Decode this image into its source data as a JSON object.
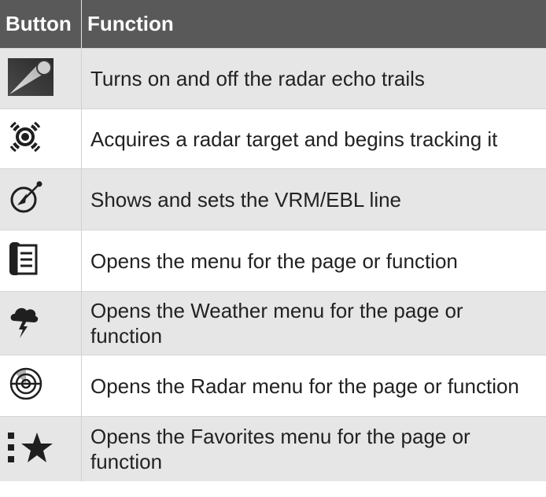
{
  "table": {
    "headers": {
      "button": "Button",
      "function": "Function"
    },
    "rows": [
      {
        "icon": "radar-echo-trails-icon",
        "text": "Turns on and off the radar echo trails"
      },
      {
        "icon": "target-acquire-icon",
        "text": "Acquires a radar target and begins tracking it"
      },
      {
        "icon": "vrm-ebl-icon",
        "text": "Shows and sets the VRM/EBL line"
      },
      {
        "icon": "menu-icon",
        "text": "Opens the menu for the page or function"
      },
      {
        "icon": "weather-storm-icon",
        "text": "Opens the Weather menu for the page or function"
      },
      {
        "icon": "radar-scope-icon",
        "text": "Opens the Radar menu for the page or function"
      },
      {
        "icon": "favorites-star-icon",
        "text": "Opens the Favorites menu for the page or function"
      }
    ]
  },
  "colors": {
    "header_bg": "#595959",
    "row_shaded": "#e6e6e6",
    "row_plain": "#ffffff",
    "icon": "#1f1f1f"
  }
}
